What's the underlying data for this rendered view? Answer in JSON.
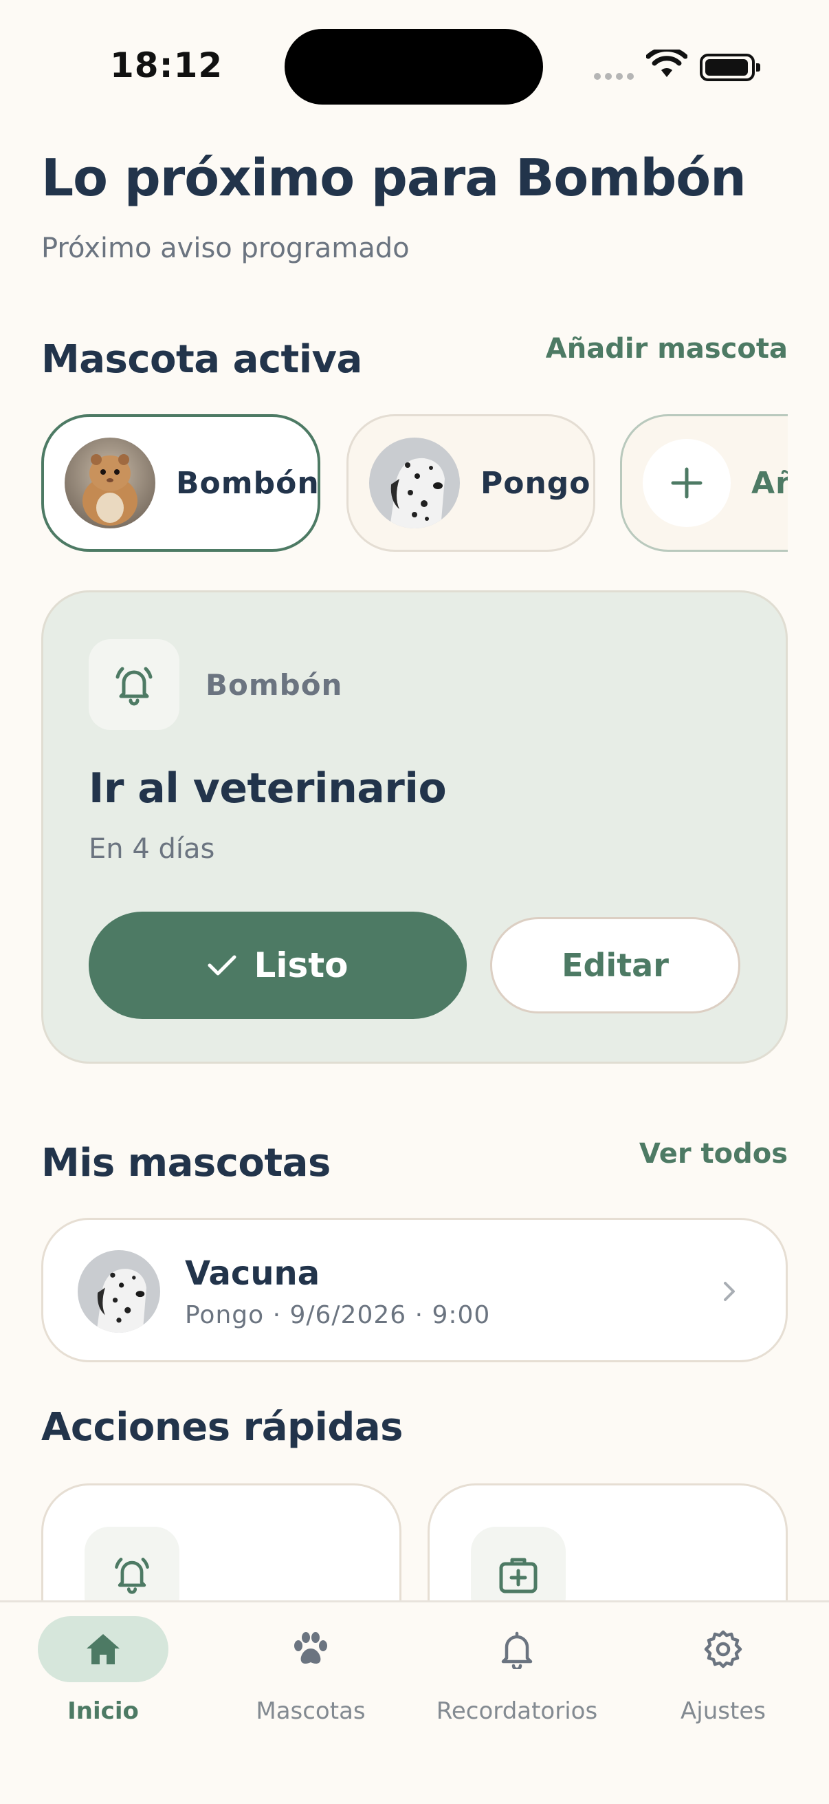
{
  "status_bar": {
    "time": "18:12"
  },
  "header": {
    "title": "Lo próximo para Bombón",
    "subtitle": "Próximo aviso programado"
  },
  "active_pet_section": {
    "title": "Mascota activa",
    "add_link": "Añadir mascota",
    "chips": [
      {
        "label": "Bombón",
        "selected": true,
        "avatar": "hamster-photo"
      },
      {
        "label": "Pongo",
        "selected": false,
        "avatar": "dalmatian-photo"
      },
      {
        "label": "Añ",
        "selected": false,
        "icon": "plus-icon"
      }
    ]
  },
  "reminder_card": {
    "pet": "Bombón",
    "icon": "bell-icon",
    "title": "Ir al veterinario",
    "when": "En 4 días",
    "done_label": "Listo",
    "edit_label": "Editar"
  },
  "my_pets_section": {
    "title": "Mis mascotas",
    "see_all": "Ver todos",
    "items": [
      {
        "title": "Vacuna",
        "subtitle": "Pongo · 9/6/2026 · 9:00",
        "avatar": "dalmatian-photo"
      }
    ]
  },
  "quick_actions_section": {
    "title": "Acciones rápidas",
    "cards": [
      {
        "icon": "bell-icon"
      },
      {
        "icon": "medical-kit-icon"
      }
    ]
  },
  "tabbar": {
    "tabs": [
      {
        "label": "Inicio",
        "icon": "home-icon",
        "active": true
      },
      {
        "label": "Mascotas",
        "icon": "paw-icon",
        "active": false
      },
      {
        "label": "Recordatorios",
        "icon": "bell-icon",
        "active": false
      },
      {
        "label": "Ajustes",
        "icon": "gear-icon",
        "active": false
      }
    ]
  },
  "colors": {
    "background": "#fdfaf5",
    "accent": "#4d7a64",
    "card_green": "#e7ede6",
    "title": "#22344b",
    "muted": "#6b7480"
  }
}
